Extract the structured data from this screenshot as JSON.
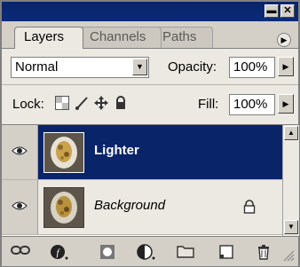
{
  "window": {
    "minimize_glyph": "▬",
    "close_glyph": "✕",
    "titlebar_color": "#0a246a"
  },
  "tabs": [
    {
      "label": "Layers",
      "active": true
    },
    {
      "label": "Channels",
      "active": false
    },
    {
      "label": "Paths",
      "active": false
    }
  ],
  "palette_menu_icon": "triangle-right-icon",
  "blend": {
    "mode": "Normal",
    "opacity_label": "Opacity:",
    "opacity_value": "100%"
  },
  "lock": {
    "label": "Lock:",
    "icons": [
      "transparency-lock-icon",
      "brush-lock-icon",
      "move-lock-icon",
      "padlock-icon"
    ],
    "fill_label": "Fill:",
    "fill_value": "100%"
  },
  "layers": [
    {
      "name": "Lighter",
      "selected": true,
      "visible": true,
      "locked": false,
      "name_style": "bold"
    },
    {
      "name": "Background",
      "selected": false,
      "visible": true,
      "locked": true,
      "name_style": "italic"
    }
  ],
  "bottom_icons": [
    "link-icon",
    "layer-style-icon",
    "layer-mask-icon",
    "adjustment-layer-icon",
    "new-group-icon",
    "new-layer-icon",
    "trash-icon"
  ],
  "colors": {
    "selection": "#0a246a",
    "panel": "#d4d0c8",
    "list_bg": "#ffffff"
  }
}
